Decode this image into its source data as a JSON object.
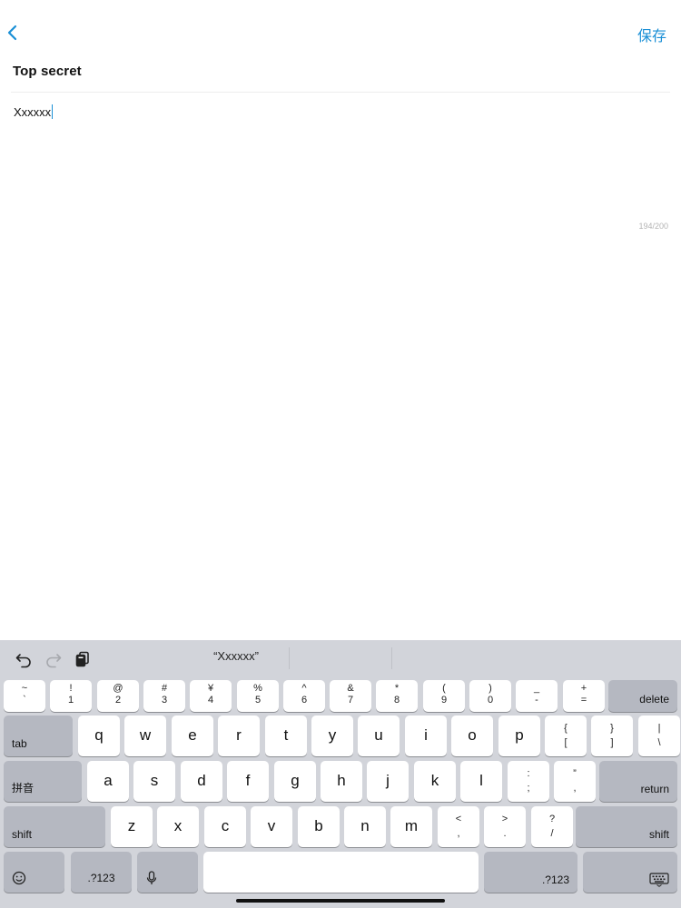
{
  "nav": {
    "save_label": "保存"
  },
  "note": {
    "title": "Top secret",
    "body": "Xxxxxx",
    "counter": "194/200"
  },
  "keyboard": {
    "suggestion": "“Xxxxxx”",
    "number_row": [
      {
        "top": "~",
        "bot": "`"
      },
      {
        "top": "!",
        "bot": "1"
      },
      {
        "top": "@",
        "bot": "2"
      },
      {
        "top": "#",
        "bot": "3"
      },
      {
        "top": "¥",
        "bot": "4"
      },
      {
        "top": "%",
        "bot": "5"
      },
      {
        "top": "^",
        "bot": "6"
      },
      {
        "top": "&",
        "bot": "7"
      },
      {
        "top": "*",
        "bot": "8"
      },
      {
        "top": "(",
        "bot": "9"
      },
      {
        "top": ")",
        "bot": "0"
      },
      {
        "top": "_",
        "bot": "-"
      },
      {
        "top": "+",
        "bot": "="
      }
    ],
    "delete": "delete",
    "tab": "tab",
    "row_q": [
      "q",
      "w",
      "e",
      "r",
      "t",
      "y",
      "u",
      "i",
      "o",
      "p"
    ],
    "row_q_sym": [
      {
        "top": "{",
        "bot": "["
      },
      {
        "top": "}",
        "bot": "]"
      },
      {
        "top": "|",
        "bot": "\\"
      }
    ],
    "pinyin": "拼音",
    "row_a": [
      "a",
      "s",
      "d",
      "f",
      "g",
      "h",
      "j",
      "k",
      "l"
    ],
    "row_a_sym": [
      {
        "top": ":",
        "bot": ";"
      },
      {
        "top": "”",
        "bot": ","
      }
    ],
    "return": "return",
    "shift": "shift",
    "row_z": [
      "z",
      "x",
      "c",
      "v",
      "b",
      "n",
      "m"
    ],
    "row_z_sym": [
      {
        "top": "<",
        "bot": ","
      },
      {
        "top": ">",
        "bot": "."
      },
      {
        "top": "?",
        "bot": "/"
      }
    ],
    "num_switch": ".?123"
  }
}
